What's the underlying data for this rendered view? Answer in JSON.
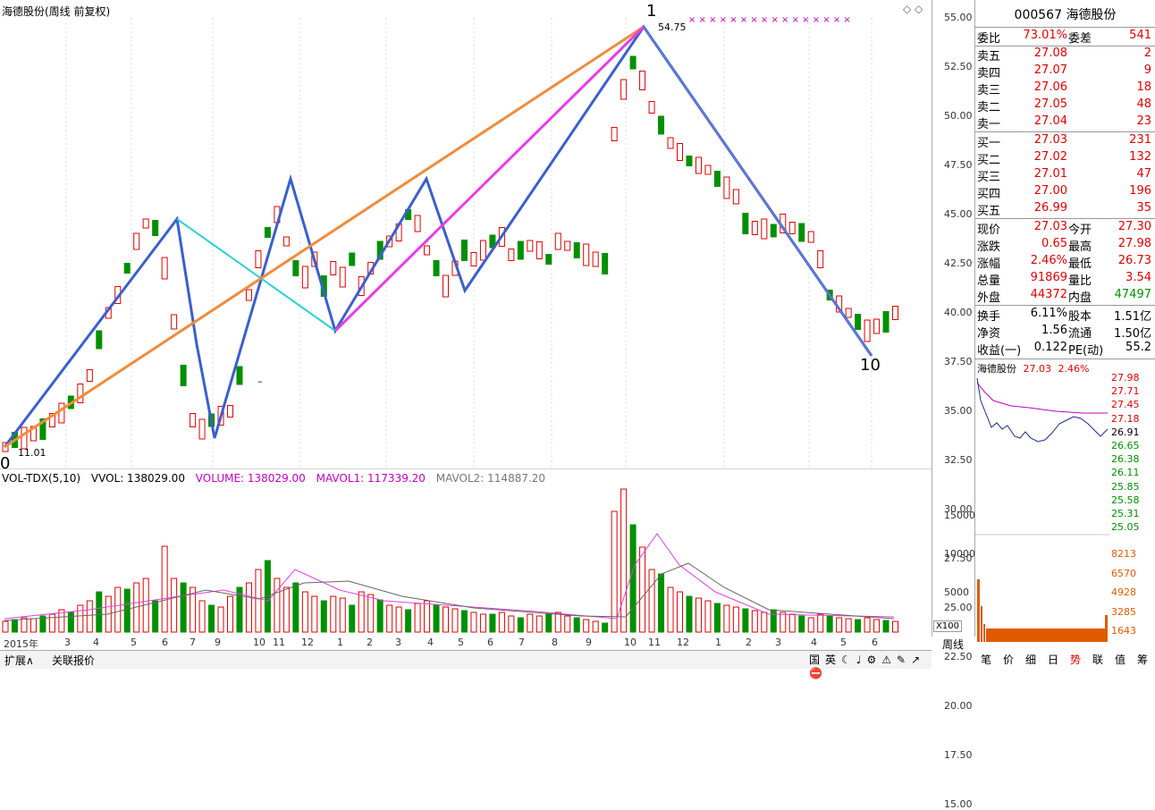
{
  "chart_title": "海德股份(周线 前复权)",
  "top_icons": "◇ ◇",
  "wave_labels": {
    "start": "0",
    "peak": "1",
    "end": "10"
  },
  "price_notes": {
    "low_price": "11.01",
    "high_price": "54.75",
    "dash": "–"
  },
  "price_axis": [
    "55.00",
    "52.50",
    "50.00",
    "47.50",
    "45.00",
    "42.50",
    "40.00",
    "37.50",
    "35.00",
    "32.50",
    "30.00",
    "27.50",
    "25.00",
    "22.50",
    "20.00",
    "17.50",
    "15.00"
  ],
  "volume_indicator": {
    "name": "VOL-TDX(5,10)",
    "vvol": "VVOL: 138029.00",
    "volume": "VOLUME: 138029.00",
    "mavol1": "MAVOL1: 117339.20",
    "mavol2": "MAVOL2: 114887.20"
  },
  "volume_axis": [
    "15000",
    "10000",
    "5000"
  ],
  "volume_unit": "X100",
  "timeline": [
    "2015年",
    "3",
    "4",
    "5",
    "6",
    "7",
    "9",
    "10",
    "11",
    "12",
    "1",
    "2",
    "3",
    "4",
    "5",
    "6",
    "7",
    "8",
    "9",
    "10",
    "11",
    "12",
    "1",
    "2",
    "3",
    "4",
    "5",
    "6"
  ],
  "bottom_tabs": [
    "扩展∧",
    "关联报价"
  ],
  "period_label": "周线",
  "status_icons": [
    "国",
    "英",
    "☾",
    "♩",
    "⚙",
    "⚠",
    "✎",
    "↗",
    "⛔"
  ],
  "quote": {
    "code_name": "000567 海德股份",
    "weibi_label": "委比",
    "weibi": "73.01%",
    "weicha_label": "委差",
    "weicha": "541",
    "sells": [
      {
        "label": "卖五",
        "price": "27.08",
        "vol": "2"
      },
      {
        "label": "卖四",
        "price": "27.07",
        "vol": "9"
      },
      {
        "label": "卖三",
        "price": "27.06",
        "vol": "18"
      },
      {
        "label": "卖二",
        "price": "27.05",
        "vol": "48"
      },
      {
        "label": "卖一",
        "price": "27.04",
        "vol": "23"
      }
    ],
    "buys": [
      {
        "label": "买一",
        "price": "27.03",
        "vol": "231"
      },
      {
        "label": "买二",
        "price": "27.02",
        "vol": "132"
      },
      {
        "label": "买三",
        "price": "27.01",
        "vol": "47"
      },
      {
        "label": "买四",
        "price": "27.00",
        "vol": "196"
      },
      {
        "label": "买五",
        "price": "26.99",
        "vol": "35"
      }
    ],
    "stats": [
      {
        "l": "现价",
        "v": "27.03",
        "vc": "red",
        "l2": "今开",
        "v2": "27.30",
        "v2c": "red"
      },
      {
        "l": "涨跌",
        "v": "0.65",
        "vc": "red",
        "l2": "最高",
        "v2": "27.98",
        "v2c": "red"
      },
      {
        "l": "涨幅",
        "v": "2.46%",
        "vc": "red",
        "l2": "最低",
        "v2": "26.73",
        "v2c": "red"
      },
      {
        "l": "总量",
        "v": "91869",
        "vc": "red",
        "l2": "量比",
        "v2": "3.54",
        "v2c": "red"
      },
      {
        "l": "外盘",
        "v": "44372",
        "vc": "red",
        "l2": "内盘",
        "v2": "47497",
        "v2c": "green"
      }
    ],
    "finance": [
      {
        "l": "换手",
        "v": "6.11%",
        "l2": "股本",
        "v2": "1.51亿"
      },
      {
        "l": "净资",
        "v": "1.56",
        "l2": "流通",
        "v2": "1.50亿"
      },
      {
        "l": "收益(一)",
        "v": "0.122",
        "l2": "PE(动)",
        "v2": "55.2"
      }
    ],
    "mini_title": "海德股份",
    "mini_price": "27.03",
    "mini_pct": "2.46%",
    "mini_ticks": [
      "27.98",
      "27.71",
      "27.45",
      "27.18",
      "26.91",
      "26.65",
      "26.38",
      "26.11",
      "25.85",
      "25.58",
      "25.31",
      "25.05"
    ],
    "mini_vol_ticks": [
      "8213",
      "6570",
      "4928",
      "3285",
      "1643"
    ],
    "bottom_buttons": [
      "笔",
      "价",
      "细",
      "日",
      "势",
      "联",
      "值",
      "筹"
    ]
  },
  "colors": {
    "up": "#e00000",
    "down": "#009000",
    "ma1": "#ff00ff",
    "ma2": "#555555"
  }
}
